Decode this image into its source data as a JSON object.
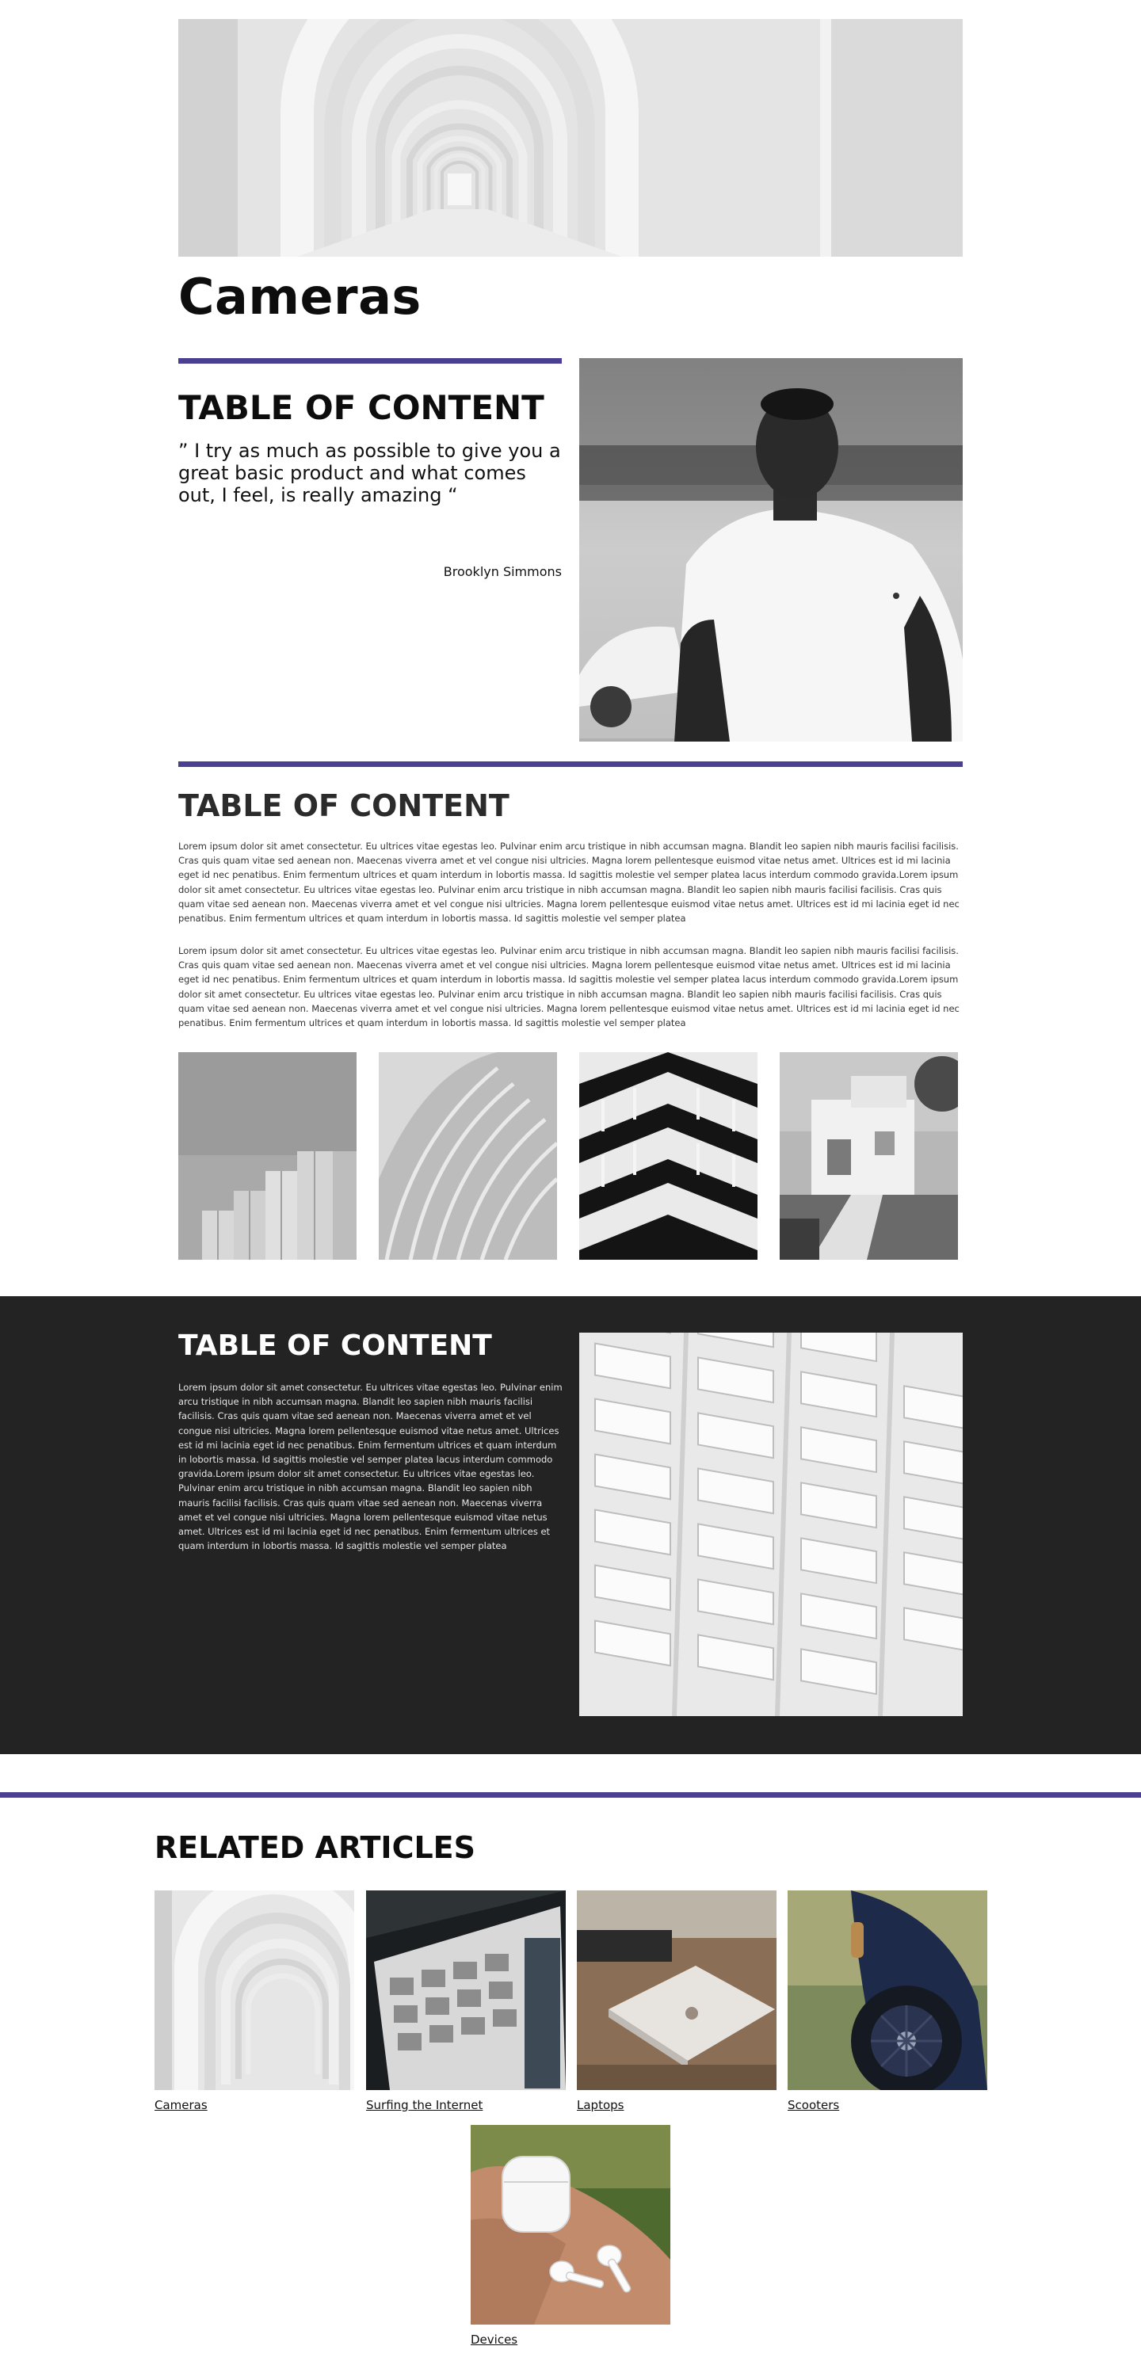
{
  "hero": {
    "image_alt": "white arched corridor"
  },
  "page_title": "Cameras",
  "quote_section": {
    "heading": "TABLE OF CONTENT",
    "quote": "” I try as much as possible to give you a great basic product and what comes out, I feel, is really amazing “",
    "author": "Brooklyn Simmons"
  },
  "text_section": {
    "heading": "TABLE OF CONTENT",
    "paragraphs": [
      "Lorem ipsum dolor sit amet consectetur. Eu ultrices vitae egestas leo. Pulvinar enim arcu tristique in nibh accumsan magna. Blandit leo sapien nibh mauris facilisi facilisis. Cras quis quam vitae sed aenean non. Maecenas viverra amet et vel congue nisi ultricies. Magna lorem pellentesque euismod vitae netus amet. Ultrices est id mi lacinia eget id nec penatibus. Enim fermentum ultrices et quam interdum in lobortis massa. Id sagittis molestie vel semper platea lacus interdum commodo gravida.Lorem ipsum dolor sit amet consectetur. Eu ultrices vitae egestas leo. Pulvinar enim arcu tristique in nibh accumsan magna. Blandit leo sapien nibh mauris facilisi facilisis. Cras quis quam vitae sed aenean non. Maecenas viverra amet et vel congue nisi ultricies. Magna lorem pellentesque euismod vitae netus amet. Ultrices est id mi lacinia eget id nec penatibus. Enim fermentum ultrices et quam interdum in lobortis massa. Id sagittis molestie vel semper platea",
      "Lorem ipsum dolor sit amet consectetur. Eu ultrices vitae egestas leo. Pulvinar enim arcu tristique in nibh accumsan magna. Blandit leo sapien nibh mauris facilisi facilisis. Cras quis quam vitae sed aenean non. Maecenas viverra amet et vel congue nisi ultricies. Magna lorem pellentesque euismod vitae netus amet. Ultrices est id mi lacinia eget id nec penatibus. Enim fermentum ultrices et quam interdum in lobortis massa. Id sagittis molestie vel semper platea lacus interdum commodo gravida.Lorem ipsum dolor sit amet consectetur. Eu ultrices vitae egestas leo. Pulvinar enim arcu tristique in nibh accumsan magna. Blandit leo sapien nibh mauris facilisi facilisis. Cras quis quam vitae sed aenean non. Maecenas viverra amet et vel congue nisi ultricies. Magna lorem pellentesque euismod vitae netus amet. Ultrices est id mi lacinia eget id nec penatibus. Enim fermentum ultrices et quam interdum in lobortis massa. Id sagittis molestie vel semper platea"
    ]
  },
  "dark_section": {
    "heading": "TABLE OF CONTENT",
    "paragraph": "Lorem ipsum dolor sit amet consectetur. Eu ultrices vitae egestas leo. Pulvinar enim arcu tristique in nibh accumsan magna. Blandit leo sapien nibh mauris facilisi facilisis. Cras quis quam vitae sed aenean non. Maecenas viverra amet et vel congue nisi ultricies. Magna lorem pellentesque euismod vitae netus amet. Ultrices est id mi lacinia eget id nec penatibus. Enim fermentum ultrices et quam interdum in lobortis massa. Id sagittis molestie vel semper platea lacus interdum commodo gravida.Lorem ipsum dolor sit amet consectetur. Eu ultrices vitae egestas leo. Pulvinar enim arcu tristique in nibh accumsan magna. Blandit leo sapien nibh mauris facilisi facilisis. Cras quis quam vitae sed aenean non. Maecenas viverra amet et vel congue nisi ultricies. Magna lorem pellentesque euismod vitae netus amet. Ultrices est id mi lacinia eget id nec penatibus. Enim fermentum ultrices et quam interdum in lobortis massa. Id sagittis molestie vel semper platea"
  },
  "related": {
    "heading": "RELATED ARTICLES",
    "articles": [
      {
        "label": "Cameras",
        "icon": "arches-image"
      },
      {
        "label": "Surfing the Internet",
        "icon": "monitor-image"
      },
      {
        "label": "Laptops",
        "icon": "laptop-image"
      },
      {
        "label": "Scooters",
        "icon": "scooter-image"
      },
      {
        "label": "Devices",
        "icon": "earbuds-image"
      }
    ]
  },
  "colors": {
    "accent": "#4b3f91",
    "dark_bg": "#232323"
  }
}
